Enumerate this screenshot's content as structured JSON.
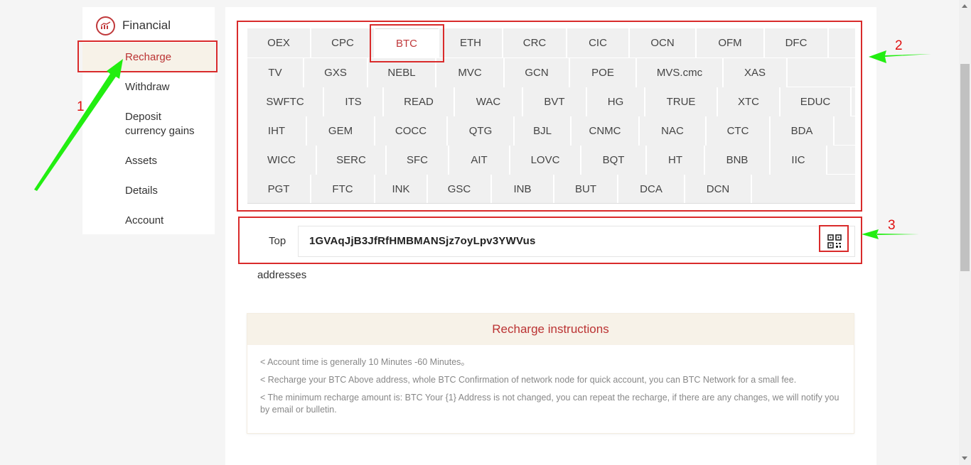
{
  "sidebar": {
    "title": "Financial",
    "icon": "chart-circle-icon",
    "items": [
      {
        "label": "Recharge",
        "active": true
      },
      {
        "label": "Withdraw"
      },
      {
        "label": "Deposit currency gains",
        "line1": "Deposit",
        "line2": "currency gains"
      },
      {
        "label": "Assets"
      },
      {
        "label": "Details"
      },
      {
        "label": "Account"
      }
    ]
  },
  "coins": {
    "selected": "BTC",
    "rows": [
      [
        "OEX",
        "CPC",
        "BTC",
        "ETH",
        "CRC",
        "CIC",
        "OCN",
        "OFM",
        "DFC"
      ],
      [
        "TV",
        "GXS",
        "NEBL",
        "MVC",
        "GCN",
        "POE",
        "MVS.cmc",
        "XAS"
      ],
      [
        "SWFTC",
        "ITS",
        "READ",
        "WAC",
        "BVT",
        "HG",
        "TRUE",
        "XTC",
        "EDUC"
      ],
      [
        "IHT",
        "GEM",
        "COCC",
        "QTG",
        "BJL",
        "CNMC",
        "NAC",
        "CTC",
        "BDA"
      ],
      [
        "WICC",
        "SERC",
        "SFC",
        "AIT",
        "LOVC",
        "BQT",
        "HT",
        "BNB",
        "IIC"
      ],
      [
        "PGT",
        "FTC",
        "INK",
        "GSC",
        "INB",
        "BUT",
        "DCA",
        "DCN"
      ]
    ]
  },
  "address": {
    "label_top": "Top",
    "label_bottom": "addresses",
    "value": "1GVAqJjB3JfRfHMBMANSjz7oyLpv3YWVus",
    "qr_icon": "qr-code-icon"
  },
  "instructions": {
    "title": "Recharge instructions",
    "lines": [
      "< Account time is generally 10 Minutes -60 Minutes。",
      "< Recharge your BTC Above address, whole BTC Confirmation of network node for quick account, you can BTC Network for a small fee.",
      "< The minimum recharge amount is: BTC Your {1} Address is not changed, you can repeat the recharge, if there are any changes, we will notify you by email or bulletin."
    ]
  },
  "annotations": {
    "n1": "1",
    "n2": "2",
    "n3": "3",
    "arrow_color": "#22ee11",
    "box_color": "#d92b2b"
  },
  "colors": {
    "accent": "#c0393b",
    "active_bg": "#f7f2e8"
  }
}
